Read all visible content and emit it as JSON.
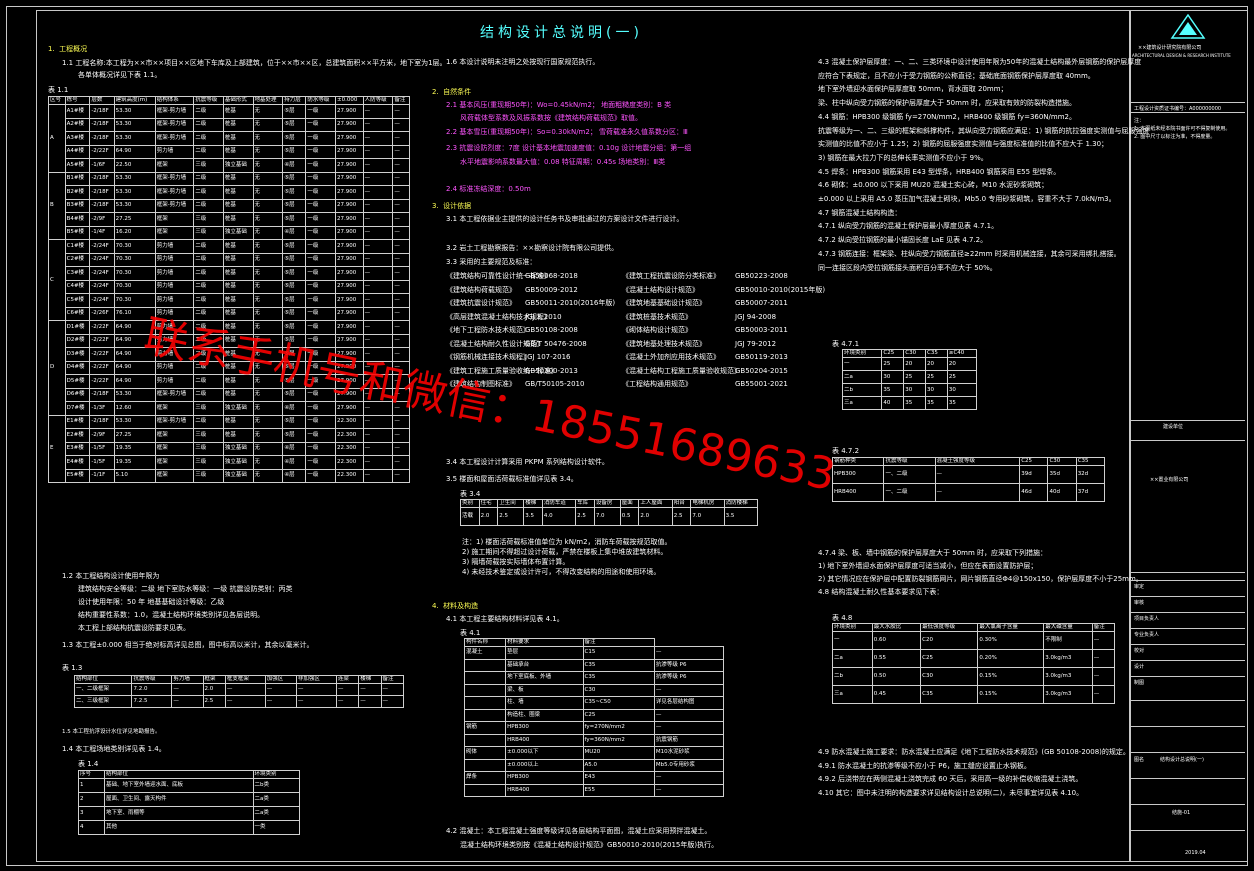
{
  "drawing": {
    "title": "结构设计总说明(一)",
    "watermark": "联系手机号和微信：18551689633"
  },
  "sections": {
    "s1": {
      "num": "1.",
      "heading": "工程概况"
    },
    "s1_1": "1.1  工程名称:本工程为××市××项目××区地下车库及上部建筑，位于××市××区，总建筑面积××平方米，地下室为1层。",
    "s1_1b": "各单体概况详见下表 1.1。",
    "table_1_1_label": "表 1.1",
    "s1_2": "1.2  本工程结构设计使用年限为",
    "s1_2b": "建筑结构安全等级：二级      地下室防水等级：一级      抗震设防类别：丙类",
    "s1_2c": "设计使用年限：50 年      地基基础设计等级：乙级",
    "s1_2d": "结构重要性系数：1.0，混凝土结构环境类别详见各层说明。",
    "s1_2e": "本工程上部结构抗震设防要求见表。",
    "s1_3": "1.3  本工程±0.000 相当于绝对标高详见总图，图中标高以米计，其余以毫米计。",
    "table_1_3_label": "表 1.3",
    "s1_4": "1.4  本工程场地类别详见表 1.4。",
    "table_1_4_label": "表 1.4",
    "s1_5": "1.5  本工程抗浮设计水位详见地勘报告。",
    "s1_6": "1.6  本设计说明未注明之处按现行国家规范执行。",
    "s2": {
      "num": "2.",
      "heading": "自然条件"
    },
    "s2_1": "2.1  基本风压(重现期50年)：Wo=0.45kN/m2；   地面粗糙度类别：B 类",
    "s2_1b": "风荷载体型系数及风振系数按《建筑结构荷载规范》取值。",
    "s2_2": "2.2  基本雪压(重现期50年)：So=0.30kN/m2；   雪荷载准永久值系数分区：Ⅲ",
    "s2_3": "2.3  抗震设防烈度：7度   设计基本地震加速度值：0.10g   设计地震分组：第一组",
    "s2_3b": "水平地震影响系数最大值：0.08   特征周期：0.45s   场地类别：Ⅲ类",
    "s2_4": "2.4  标准冻结深度：0.50m",
    "s3": {
      "num": "3.",
      "heading": "设计依据"
    },
    "s3_1": "3.1  本工程依据业主提供的设计任务书及审批通过的方案设计文件进行设计。",
    "s3_2": "3.2  岩土工程勘察报告：××勘察设计院有限公司提供。",
    "s3_3": "3.3  采用的主要规范及标准：",
    "codes": [
      [
        "《建筑结构可靠性设计统一标准》",
        "GB50068-2018",
        "《建筑工程抗震设防分类标准》",
        "GB50223-2008"
      ],
      [
        "《建筑结构荷载规范》",
        "GB50009-2012",
        "《混凝土结构设计规范》",
        "GB50010-2010(2015年版)"
      ],
      [
        "《建筑抗震设计规范》",
        "GB50011-2010(2016年版)",
        "《建筑地基基础设计规范》",
        "GB50007-2011"
      ],
      [
        "《高层建筑混凝土结构技术规程》",
        "JGJ 3-2010",
        "《建筑桩基技术规范》",
        "JGJ 94-2008"
      ],
      [
        "《地下工程防水技术规范》",
        "GB50108-2008",
        "《砌体结构设计规范》",
        "GB50003-2011"
      ],
      [
        "《混凝土结构耐久性设计规范》",
        "GB/T 50476-2008",
        "《建筑地基处理技术规范》",
        "JGJ 79-2012"
      ],
      [
        "《钢筋机械连接技术规程》",
        "JGJ 107-2016",
        "《混凝土外加剂应用技术规范》",
        "GB50119-2013"
      ],
      [
        "《建筑工程施工质量验收统一标准》",
        "GB50300-2013",
        "《混凝土结构工程施工质量验收规范》",
        "GB50204-2015"
      ],
      [
        "《建筑结构制图标准》",
        "GB/T50105-2010",
        "《工程结构通用规范》",
        "GB55001-2021"
      ]
    ],
    "s3_4": "3.4  本工程设计计算采用 PKPM 系列结构设计软件。",
    "s3_5": "3.5  楼面和屋面活荷载标准值详见表 3.4。",
    "table_3_4_label": "表 3.4",
    "table_3_4": {
      "head": [
        "类别",
        "住宅",
        "卫生间",
        "楼梯",
        "消防车道",
        "车库",
        "设备房",
        "屋面",
        "上人屋面",
        "阳台",
        "电梯机房",
        "消防楼梯"
      ],
      "vals": [
        "活载",
        "2.0",
        "2.5",
        "3.5",
        "4.0",
        "2.5",
        "7.0",
        "0.5",
        "2.0",
        "2.5",
        "7.0",
        "3.5"
      ]
    },
    "notes_3_4": [
      "注：1) 楼面活荷载标准值单位为 kN/m2，消防车荷载按规范取值。",
      "2) 施工期间不得超过设计荷载，严禁在楼板上集中堆放建筑材料。",
      "3) 隔墙荷载按实际墙体布置计算。",
      "4) 未经技术鉴定或设计许可，不得改变结构的用途和使用环境。"
    ],
    "s4": {
      "num": "4.",
      "heading": "材料及构造"
    },
    "s4_1": "4.1  本工程主要结构材料详见表 4.1。",
    "table_4_1_label": "表 4.1",
    "table_4_1_head": [
      "构件名称",
      "材料要求",
      "备注"
    ],
    "s4_2": "4.2  混凝土：本工程混凝土强度等级详见各层结构平面图，混凝土应采用预拌混凝土。",
    "s4_2b": "混凝土结构环境类别按《混凝土结构设计规范》GB50010-2010(2015年版)执行。",
    "right_col": [
      "4.3  混凝土保护层厚度：一、二、三类环境中设计使用年限为50年的混凝土结构最外层钢筋的保护层厚度",
      "应符合下表规定，且不应小于受力钢筋的公称直径；基础底面钢筋保护层厚度取 40mm。",
      "地下室外墙迎水面保护层厚度取 50mm，背水面取 20mm；",
      "梁、柱中纵向受力钢筋的保护层厚度大于 50mm 时，应采取有效的防裂构造措施。",
      "4.4  钢筋：HPB300 级钢筋 fy=270N/mm2，HRB400 级钢筋 fy=360N/mm2。",
      "抗震等级为一、二、三级的框架和斜撑构件，其纵向受力钢筋应满足：1) 钢筋的抗拉强度实测值与屈服强度",
      "实测值的比值不应小于 1.25；2) 钢筋的屈服强度实测值与强度标准值的比值不应大于 1.30；",
      "3) 钢筋在最大拉力下的总伸长率实测值不应小于 9%。",
      "4.5  焊条：HPB300 钢筋采用 E43 型焊条，HRB400 钢筋采用 E55 型焊条。",
      "4.6  砌体：±0.000 以下采用 MU20 混凝土实心砖，M10 水泥砂浆砌筑；",
      "±0.000 以上采用 A5.0 蒸压加气混凝土砌块，Mb5.0 专用砂浆砌筑，容重不大于 7.0kN/m3。",
      "4.7  钢筋混凝土结构构造：",
      "4.7.1  纵向受力钢筋的混凝土保护层最小厚度见表 4.7.1。",
      "4.7.2  纵向受拉钢筋的最小锚固长度 LaE 见表 4.7.2。",
      "4.7.3  钢筋连接：框架梁、柱纵向受力钢筋直径≥22mm 时采用机械连接，其余可采用绑扎搭接。",
      "同一连接区段内受拉钢筋接头面积百分率不应大于 50%。"
    ],
    "table_4_7_1_label": "表 4.7.1",
    "table_4_7_2_label": "表 4.7.2",
    "right_col2": [
      "4.7.4  梁、板、墙中钢筋的保护层厚度大于 50mm 时，应采取下列措施：",
      "1) 地下室外墙迎水面保护层厚度可适当减小，但应在表面设置防护层；",
      "2) 其它情况应在保护层中配置防裂钢筋网片，网片钢筋直径Φ4@150x150，保护层厚度不小于25mm。",
      "4.8  结构混凝土耐久性基本要求见下表："
    ],
    "table_4_8_label": "表 4.8",
    "right_col3": [
      "4.9  防水混凝土施工要求：防水混凝土应满足《地下工程防水技术规范》(GB 50108-2008)的规定。",
      "4.9.1  防水混凝土的抗渗等级不应小于 P6，施工缝应设置止水钢板。",
      "4.9.2  后浇带应在两侧混凝土浇筑完成 60 天后，采用高一级的补偿收缩混凝土浇筑。",
      "4.10  其它：图中未注明的构造要求详见结构设计总说明(二)，未尽事宜详见表 4.10。"
    ]
  },
  "table_1_1": {
    "head": [
      "区号",
      "栋号",
      "层数",
      "建筑高度(m)",
      "结构体系",
      "抗震等级",
      "基础形式",
      "地基处理",
      "持力层",
      "防水等级",
      "±0.000",
      "人防等级",
      "备注"
    ],
    "groups": [
      {
        "zone": "A",
        "rows": [
          [
            "A1#楼",
            "-2/18F",
            "53.30",
            "框架-剪力墙",
            "二级",
            "桩基",
            "无",
            "⑤层",
            "一级",
            "27.900",
            "—",
            "—"
          ],
          [
            "A2#楼",
            "-2/18F",
            "53.30",
            "框架-剪力墙",
            "二级",
            "桩基",
            "无",
            "⑤层",
            "一级",
            "27.900",
            "—",
            "—"
          ],
          [
            "A3#楼",
            "-2/18F",
            "53.30",
            "框架-剪力墙",
            "二级",
            "桩基",
            "无",
            "⑤层",
            "一级",
            "27.900",
            "—",
            "—"
          ],
          [
            "A4#楼",
            "-2/22F",
            "64.90",
            "剪力墙",
            "二级",
            "桩基",
            "无",
            "⑤层",
            "一级",
            "27.900",
            "—",
            "—"
          ],
          [
            "A5#楼",
            "-1/6F",
            "22.50",
            "框架",
            "三级",
            "独立基础",
            "无",
            "④层",
            "一级",
            "27.900",
            "—",
            "—"
          ]
        ]
      },
      {
        "zone": "B",
        "rows": [
          [
            "B1#楼",
            "-2/18F",
            "53.30",
            "框架-剪力墙",
            "二级",
            "桩基",
            "无",
            "⑤层",
            "一级",
            "27.900",
            "—",
            "—"
          ],
          [
            "B2#楼",
            "-2/18F",
            "53.30",
            "框架-剪力墙",
            "二级",
            "桩基",
            "无",
            "⑤层",
            "一级",
            "27.900",
            "—",
            "—"
          ],
          [
            "B3#楼",
            "-2/18F",
            "53.30",
            "框架-剪力墙",
            "二级",
            "桩基",
            "无",
            "⑤层",
            "一级",
            "27.900",
            "—",
            "—"
          ],
          [
            "B4#楼",
            "-2/9F",
            "27.25",
            "框架",
            "三级",
            "桩基",
            "无",
            "⑤层",
            "一级",
            "27.900",
            "—",
            "—"
          ],
          [
            "B5#楼",
            "-1/4F",
            "16.20",
            "框架",
            "三级",
            "独立基础",
            "无",
            "④层",
            "一级",
            "27.900",
            "—",
            "—"
          ]
        ]
      },
      {
        "zone": "C",
        "rows": [
          [
            "C1#楼",
            "-2/24F",
            "70.30",
            "剪力墙",
            "二级",
            "桩基",
            "无",
            "⑤层",
            "一级",
            "27.900",
            "—",
            "—"
          ],
          [
            "C2#楼",
            "-2/24F",
            "70.30",
            "剪力墙",
            "二级",
            "桩基",
            "无",
            "⑤层",
            "一级",
            "27.900",
            "—",
            "—"
          ],
          [
            "C3#楼",
            "-2/24F",
            "70.30",
            "剪力墙",
            "二级",
            "桩基",
            "无",
            "⑤层",
            "一级",
            "27.900",
            "—",
            "—"
          ],
          [
            "C4#楼",
            "-2/24F",
            "70.30",
            "剪力墙",
            "二级",
            "桩基",
            "无",
            "⑤层",
            "一级",
            "27.900",
            "—",
            "—"
          ],
          [
            "C5#楼",
            "-2/24F",
            "70.30",
            "剪力墙",
            "二级",
            "桩基",
            "无",
            "⑤层",
            "一级",
            "27.900",
            "—",
            "—"
          ],
          [
            "C6#楼",
            "-2/26F",
            "76.10",
            "剪力墙",
            "二级",
            "桩基",
            "无",
            "⑤层",
            "一级",
            "27.900",
            "—",
            "—"
          ]
        ]
      },
      {
        "zone": "D",
        "rows": [
          [
            "D1#楼",
            "-2/22F",
            "64.90",
            "剪力墙",
            "二级",
            "桩基",
            "无",
            "⑤层",
            "一级",
            "27.900",
            "—",
            "—"
          ],
          [
            "D2#楼",
            "-2/22F",
            "64.90",
            "剪力墙",
            "二级",
            "桩基",
            "无",
            "⑤层",
            "一级",
            "27.900",
            "—",
            "—"
          ],
          [
            "D3#楼",
            "-2/22F",
            "64.90",
            "剪力墙",
            "二级",
            "桩基",
            "无",
            "⑤层",
            "一级",
            "27.900",
            "—",
            "—"
          ],
          [
            "D4#楼",
            "-2/22F",
            "64.90",
            "剪力墙",
            "二级",
            "桩基",
            "无",
            "⑤层",
            "一级",
            "27.900",
            "—",
            "—"
          ],
          [
            "D5#楼",
            "-2/22F",
            "64.90",
            "剪力墙",
            "二级",
            "桩基",
            "无",
            "⑤层",
            "一级",
            "27.900",
            "—",
            "—"
          ],
          [
            "D6#楼",
            "-2/18F",
            "53.30",
            "框架-剪力墙",
            "二级",
            "桩基",
            "无",
            "⑤层",
            "一级",
            "27.900",
            "—",
            "—"
          ],
          [
            "D7#楼",
            "-1/3F",
            "12.60",
            "框架",
            "三级",
            "独立基础",
            "无",
            "④层",
            "一级",
            "27.900",
            "—",
            "—"
          ]
        ]
      },
      {
        "zone": "E",
        "rows": [
          [
            "E1#楼",
            "-2/18F",
            "53.30",
            "框架-剪力墙",
            "二级",
            "桩基",
            "无",
            "⑤层",
            "一级",
            "22.300",
            "—",
            "—"
          ],
          [
            "E2#楼",
            "-2/9F",
            "27.25",
            "框架",
            "三级",
            "桩基",
            "无",
            "⑤层",
            "一级",
            "22.300",
            "—",
            "—"
          ],
          [
            "E3#楼",
            "-1/5F",
            "19.35",
            "框架",
            "三级",
            "独立基础",
            "无",
            "④层",
            "一级",
            "22.300",
            "—",
            "—"
          ],
          [
            "E4#楼",
            "-1/5F",
            "19.35",
            "框架",
            "三级",
            "独立基础",
            "无",
            "④层",
            "一级",
            "22.300",
            "—",
            "—"
          ],
          [
            "E5#楼",
            "-1/1F",
            "5.10",
            "框架",
            "三级",
            "独立基础",
            "无",
            "④层",
            "一级",
            "22.300",
            "—",
            "—"
          ]
        ]
      }
    ]
  },
  "table_1_3": {
    "head": [
      "结构部位",
      "抗震等级",
      "剪力墙",
      "框架",
      "框支框架",
      "加强区",
      "非加强区",
      "连梁",
      "楼梯",
      "备注"
    ],
    "rows": [
      [
        "一、二级框架",
        "7.2.0",
        "—",
        "2.0",
        "—",
        "—",
        "—",
        "—",
        "—",
        "—"
      ],
      [
        "二、三级框架",
        "7.2.5",
        "—",
        "2.5",
        "—",
        "—",
        "—",
        "—",
        "—",
        "—"
      ]
    ]
  },
  "table_1_4": {
    "head": [
      "序号",
      "结构部位",
      "环境类别"
    ],
    "rows": [
      [
        "1",
        "基础、地下室外墙迎水面、底板",
        "二b类"
      ],
      [
        "2",
        "屋面、卫生间、露天构件",
        "二a类"
      ],
      [
        "3",
        "地下室、雨棚等",
        "二a类"
      ],
      [
        "4",
        "其他",
        "一类"
      ]
    ]
  },
  "table_4_1": [
    [
      "混凝土",
      "垫层",
      "C15",
      "—"
    ],
    [
      "",
      "基础承台",
      "C35",
      "抗渗等级 P6"
    ],
    [
      "",
      "地下室底板、外墙",
      "C35",
      "抗渗等级 P6"
    ],
    [
      "",
      "梁、板",
      "C30",
      "—"
    ],
    [
      "",
      "柱、墙",
      "C35~C50",
      "详见各层结构图"
    ],
    [
      "",
      "构造柱、圈梁",
      "C25",
      "—"
    ],
    [
      "钢筋",
      "HPB300",
      "fy=270N/mm2",
      "—"
    ],
    [
      "",
      "HRB400",
      "fy=360N/mm2",
      "抗震钢筋"
    ],
    [
      "砌体",
      "±0.000以下",
      "MU20",
      "M10水泥砂浆"
    ],
    [
      "",
      "±0.000以上",
      "A5.0",
      "Mb5.0专用砂浆"
    ],
    [
      "焊条",
      "HPB300",
      "E43",
      "—"
    ],
    [
      "",
      "HRB400",
      "E55",
      "—"
    ]
  ],
  "table_4_7_1": {
    "head": [
      "环境类别",
      "C25",
      "C30",
      "C35",
      "≥C40"
    ],
    "rows": [
      [
        "一",
        "25",
        "20",
        "20",
        "20"
      ],
      [
        "二a",
        "30",
        "25",
        "25",
        "25"
      ],
      [
        "二b",
        "35",
        "30",
        "30",
        "30"
      ],
      [
        "三a",
        "40",
        "35",
        "35",
        "35"
      ]
    ]
  },
  "table_4_7_2": {
    "head": [
      "钢筋种类",
      "抗震等级",
      "混凝土强度等级",
      "C25",
      "C30",
      "C35"
    ],
    "rows": [
      [
        "HPB300",
        "一、二级",
        "—",
        "39d",
        "35d",
        "32d"
      ],
      [
        "HRB400",
        "一、二级",
        "—",
        "46d",
        "40d",
        "37d"
      ]
    ]
  },
  "table_4_8": {
    "head": [
      "环境类别",
      "最大水胶比",
      "最低强度等级",
      "最大氯离子含量",
      "最大碱含量",
      "备注"
    ],
    "rows": [
      [
        "一",
        "0.60",
        "C20",
        "0.30%",
        "不限制",
        "—"
      ],
      [
        "二a",
        "0.55",
        "C25",
        "0.20%",
        "3.0kg/m3",
        "—"
      ],
      [
        "二b",
        "0.50",
        "C30",
        "0.15%",
        "3.0kg/m3",
        "—"
      ],
      [
        "三a",
        "0.45",
        "C35",
        "0.15%",
        "3.0kg/m3",
        "—"
      ]
    ]
  },
  "title_block": {
    "company": "××建筑设计研究院有限公司",
    "company_en": "ARCHITECTURAL DESIGN & RESEARCH INSTITUTE",
    "cert": "工程设计资质证书编号：A000000000",
    "notes": [
      "注：",
      "1. 本图纸未经本院书面许可不得复制使用。",
      "2. 图中尺寸以标注为准，不得度量。"
    ],
    "project_label": "建设单位",
    "project": "××置业有限公司",
    "drawing_name_label": "图名",
    "drawing_name": "结构设计总说明(一)",
    "sheet_no": "结施-01",
    "rows": [
      "审定",
      "审核",
      "项目负责人",
      "专业负责人",
      "校对",
      "设计",
      "制图"
    ],
    "date": "2019.04"
  }
}
